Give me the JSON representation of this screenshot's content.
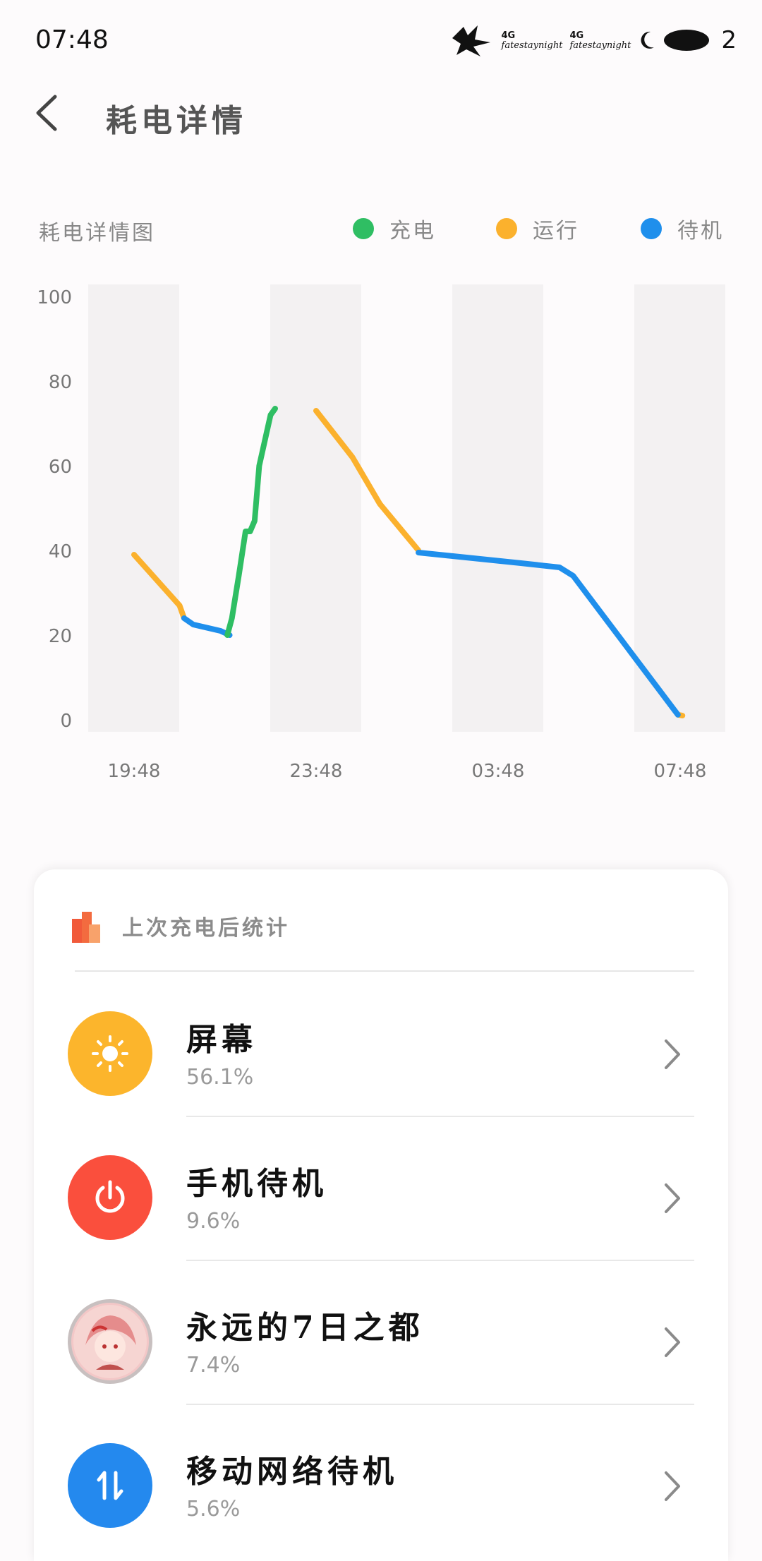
{
  "status_bar": {
    "time": "07:48",
    "carrier_text_1": "fatestaynight",
    "carrier_text_2": "fatestaynight",
    "signal_1": "4G",
    "signal_2": "4G",
    "battery_level": "2"
  },
  "header": {
    "title": "耗电详情"
  },
  "chart": {
    "title": "耗电详情图",
    "legend": [
      {
        "label": "充电",
        "color": "#2fbe63"
      },
      {
        "label": "运行",
        "color": "#fbb12d"
      },
      {
        "label": "待机",
        "color": "#1f8fec"
      }
    ]
  },
  "chart_data": {
    "type": "line",
    "title": "耗电详情图",
    "xlabel": "",
    "ylabel": "",
    "ylim": [
      0,
      100
    ],
    "y_ticks": [
      "100",
      "80",
      "60",
      "40",
      "20",
      "0"
    ],
    "x_ticks": [
      "19:48",
      "23:48",
      "03:48",
      "07:48"
    ],
    "x_unit": "hours since 19:48",
    "series": [
      {
        "name": "运行",
        "color": "#fbb12d",
        "segments": [
          [
            [
              0,
              39
            ],
            [
              1.0,
              27
            ],
            [
              1.1,
              24
            ]
          ],
          [
            [
              4.0,
              73
            ],
            [
              4.8,
              62
            ],
            [
              5.4,
              51
            ],
            [
              6.25,
              40
            ]
          ],
          [
            [
              11.95,
              1.2
            ],
            [
              12.05,
              1
            ]
          ]
        ]
      },
      {
        "name": "待机",
        "color": "#1f8fec",
        "segments": [
          [
            [
              1.1,
              24
            ],
            [
              1.3,
              22.5
            ],
            [
              1.9,
              21
            ],
            [
              2.1,
              20
            ]
          ],
          [
            [
              6.25,
              39.5
            ],
            [
              8.5,
              37
            ],
            [
              9.35,
              36
            ],
            [
              9.65,
              34
            ],
            [
              11.95,
              1.2
            ]
          ]
        ]
      },
      {
        "name": "充电",
        "color": "#2fbe63",
        "segments": [
          [
            [
              2.05,
              20
            ],
            [
              2.15,
              24
            ],
            [
              2.3,
              34
            ],
            [
              2.45,
              44.5
            ],
            [
              2.55,
              44.5
            ],
            [
              2.65,
              47
            ],
            [
              2.75,
              60
            ],
            [
              3.0,
              72
            ],
            [
              3.1,
              73.5
            ]
          ]
        ]
      }
    ]
  },
  "stats": {
    "title": "上次充电后统计",
    "items": [
      {
        "name": "屏幕",
        "percent": "56.1%",
        "icon": "sun-icon",
        "color": "#fcb52c"
      },
      {
        "name": "手机待机",
        "percent": "9.6%",
        "icon": "power-icon",
        "color": "#fa4f3d"
      },
      {
        "name": "永远的7日之都",
        "percent": "7.4%",
        "icon": "app-icon",
        "color": "#f3c7c7"
      },
      {
        "name": "移动网络待机",
        "percent": "5.6%",
        "icon": "mobile-data-icon",
        "color": "#2489ee"
      }
    ]
  }
}
